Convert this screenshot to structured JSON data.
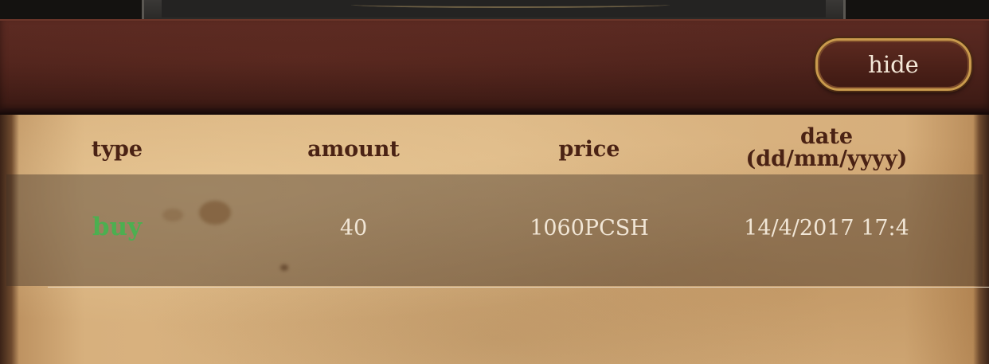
{
  "header": {
    "hide_label": "hide"
  },
  "table": {
    "columns": {
      "type": "type",
      "amount": "amount",
      "price": "price",
      "date_line1": "date",
      "date_line2": "(dd/mm/yyyy)"
    },
    "rows": [
      {
        "type": "buy",
        "amount": "40",
        "price": "1060PCSH",
        "date": "14/4/2017 17:4"
      }
    ]
  },
  "colors": {
    "buy": "#4caf50",
    "header_text": "#4a2214",
    "cell_text": "#f1e6d6",
    "button_border": "#c99a4d"
  }
}
